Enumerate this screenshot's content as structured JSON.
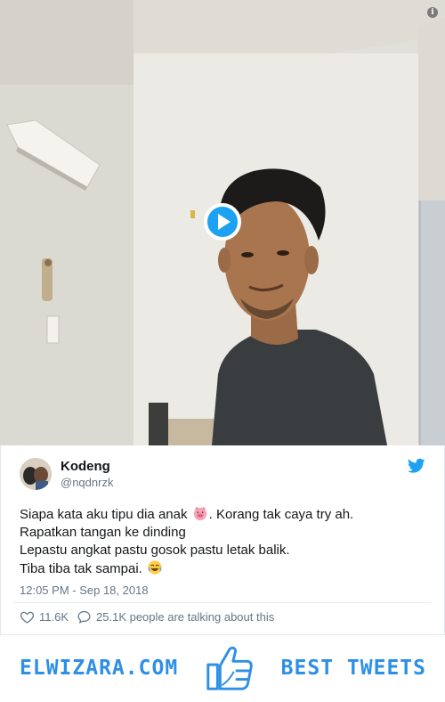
{
  "video": {
    "info_icon": "info-icon",
    "play_icon": "play-circle-icon"
  },
  "tweet": {
    "author_name": "Kodeng",
    "author_handle": "@nqdnrzk",
    "brand_icon": "twitter-bird-icon",
    "text_lines": [
      {
        "before": "Siapa kata aku tipu dia anak ",
        "emoji": "pig-face-emoji",
        "after": ". Korang tak caya try ah."
      },
      {
        "before": "Rapatkan tangan ke dinding",
        "emoji": "",
        "after": ""
      },
      {
        "before": "Lepastu angkat pastu gosok pastu letak balik.",
        "emoji": "",
        "after": ""
      },
      {
        "before": "Tiba tiba tak sampai. ",
        "emoji": "tears-of-joy-emoji",
        "after": ""
      }
    ],
    "timestamp": "12:05 PM - Sep 18, 2018",
    "likes": "11.6K",
    "replies_text": "25.1K people are talking about this"
  },
  "banner": {
    "left_text": "ELWIZARA.COM",
    "right_text": "BEST TWEETS",
    "logo_icon": "thumbs-up-icon",
    "accent_color": "#2d8fe6"
  },
  "colors": {
    "twitter_blue": "#1da1f2",
    "text_primary": "#14171a",
    "text_secondary": "#657786"
  }
}
